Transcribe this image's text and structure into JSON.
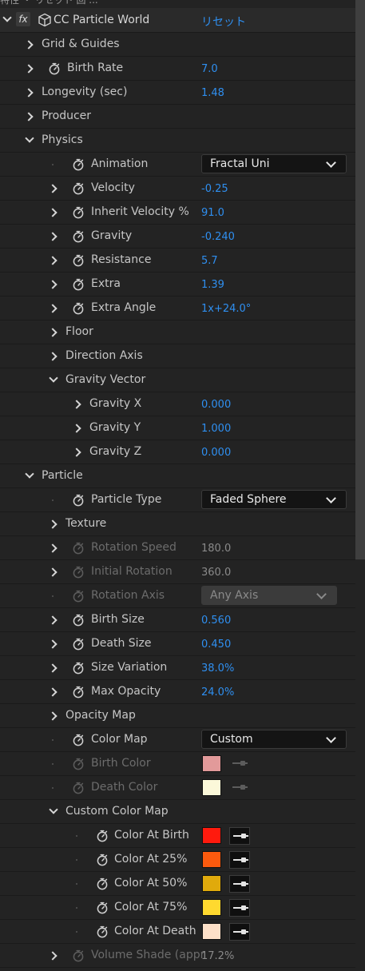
{
  "header_fragment": "特性 ・ リセット 回 ...",
  "effect": {
    "badge": "fx",
    "name": "CC Particle World",
    "reset_label": "リセット",
    "cube_icon": "plugin-cube-icon"
  },
  "rows": [
    {
      "id": "grid-guides",
      "label": "Grid & Guides",
      "level": 1,
      "twirl": "closed",
      "stopwatch": false
    },
    {
      "id": "birth-rate",
      "label": "Birth Rate",
      "level": 1,
      "twirl": "closed",
      "stopwatch": true,
      "value": "7.0"
    },
    {
      "id": "longevity",
      "label": "Longevity (sec)",
      "level": 1,
      "twirl": "closed",
      "stopwatch": false,
      "value": "1.48"
    },
    {
      "id": "producer",
      "label": "Producer",
      "level": 1,
      "twirl": "closed",
      "stopwatch": false
    },
    {
      "id": "physics",
      "label": "Physics",
      "level": 1,
      "twirl": "open",
      "stopwatch": false
    },
    {
      "id": "animation",
      "label": "Animation",
      "level": 2,
      "twirl": "dot",
      "stopwatch": true,
      "dropdown": "Fractal Uni"
    },
    {
      "id": "velocity",
      "label": "Velocity",
      "level": 2,
      "twirl": "closed",
      "stopwatch": true,
      "value": "-0.25"
    },
    {
      "id": "inherit-velocity",
      "label": "Inherit Velocity %",
      "level": 2,
      "twirl": "closed",
      "stopwatch": true,
      "value": "91.0"
    },
    {
      "id": "gravity",
      "label": "Gravity",
      "level": 2,
      "twirl": "closed",
      "stopwatch": true,
      "value": "-0.240"
    },
    {
      "id": "resistance",
      "label": "Resistance",
      "level": 2,
      "twirl": "closed",
      "stopwatch": true,
      "value": "5.7"
    },
    {
      "id": "extra",
      "label": "Extra",
      "level": 2,
      "twirl": "closed",
      "stopwatch": true,
      "value": "1.39"
    },
    {
      "id": "extra-angle",
      "label": "Extra Angle",
      "level": 2,
      "twirl": "closed",
      "stopwatch": true,
      "value": "1x+24.0°"
    },
    {
      "id": "floor",
      "label": "Floor",
      "level": 2,
      "twirl": "closed",
      "stopwatch": false
    },
    {
      "id": "direction-axis",
      "label": "Direction Axis",
      "level": 2,
      "twirl": "closed",
      "stopwatch": false
    },
    {
      "id": "gravity-vector",
      "label": "Gravity Vector",
      "level": 2,
      "twirl": "open",
      "stopwatch": false
    },
    {
      "id": "gravity-x",
      "label": "Gravity X",
      "level": 3,
      "twirl": "closed",
      "stopwatch": false,
      "value": "0.000"
    },
    {
      "id": "gravity-y",
      "label": "Gravity Y",
      "level": 3,
      "twirl": "closed",
      "stopwatch": false,
      "value": "1.000"
    },
    {
      "id": "gravity-z",
      "label": "Gravity Z",
      "level": 3,
      "twirl": "closed",
      "stopwatch": false,
      "value": "0.000"
    },
    {
      "id": "particle",
      "label": "Particle",
      "level": 1,
      "twirl": "open",
      "stopwatch": false
    },
    {
      "id": "particle-type",
      "label": "Particle Type",
      "level": 2,
      "twirl": "dot",
      "stopwatch": true,
      "dropdown": "Faded Sphere"
    },
    {
      "id": "texture",
      "label": "Texture",
      "level": 2,
      "twirl": "closed",
      "stopwatch": false
    },
    {
      "id": "rotation-speed",
      "label": "Rotation Speed",
      "level": 2,
      "twirl": "closed",
      "stopwatch": true,
      "value": "180.0",
      "disabled": true
    },
    {
      "id": "initial-rotation",
      "label": "Initial Rotation",
      "level": 2,
      "twirl": "closed",
      "stopwatch": true,
      "value": "360.0",
      "disabled": true
    },
    {
      "id": "rotation-axis",
      "label": "Rotation Axis",
      "level": 2,
      "twirl": "dot",
      "stopwatch": true,
      "dropdown": "Any Axis",
      "disabled": true
    },
    {
      "id": "birth-size",
      "label": "Birth Size",
      "level": 2,
      "twirl": "closed",
      "stopwatch": true,
      "value": "0.560"
    },
    {
      "id": "death-size",
      "label": "Death Size",
      "level": 2,
      "twirl": "closed",
      "stopwatch": true,
      "value": "0.450"
    },
    {
      "id": "size-variation",
      "label": "Size Variation",
      "level": 2,
      "twirl": "closed",
      "stopwatch": true,
      "value": "38.0%"
    },
    {
      "id": "max-opacity",
      "label": "Max Opacity",
      "level": 2,
      "twirl": "closed",
      "stopwatch": true,
      "value": "24.0%"
    },
    {
      "id": "opacity-map",
      "label": "Opacity Map",
      "level": 2,
      "twirl": "closed",
      "stopwatch": false
    },
    {
      "id": "color-map",
      "label": "Color Map",
      "level": 2,
      "twirl": "dot",
      "stopwatch": true,
      "dropdown": "Custom"
    },
    {
      "id": "birth-color",
      "label": "Birth Color",
      "level": 2,
      "twirl": "dot",
      "stopwatch": true,
      "disabled": true,
      "color": "#e29a9a",
      "eyedropper": true
    },
    {
      "id": "death-color",
      "label": "Death Color",
      "level": 2,
      "twirl": "dot",
      "stopwatch": true,
      "disabled": true,
      "color": "#fbf8d9",
      "eyedropper": true
    },
    {
      "id": "custom-color-map",
      "label": "Custom Color Map",
      "level": 2,
      "twirl": "open",
      "stopwatch": false
    },
    {
      "id": "color-at-birth",
      "label": "Color At Birth",
      "level": 3,
      "twirl": "dot",
      "stopwatch": true,
      "color": "#ff1a0d",
      "eyedropper": true
    },
    {
      "id": "color-at-25",
      "label": "Color At 25%",
      "level": 3,
      "twirl": "dot",
      "stopwatch": true,
      "color": "#fb5a0e",
      "eyedropper": true
    },
    {
      "id": "color-at-50",
      "label": "Color At 50%",
      "level": 3,
      "twirl": "dot",
      "stopwatch": true,
      "color": "#e0aa0c",
      "eyedropper": true
    },
    {
      "id": "color-at-75",
      "label": "Color At 75%",
      "level": 3,
      "twirl": "dot",
      "stopwatch": true,
      "color": "#ffd92f",
      "eyedropper": true
    },
    {
      "id": "color-at-death",
      "label": "Color At Death",
      "level": 3,
      "twirl": "dot",
      "stopwatch": true,
      "color": "#fde0c8",
      "eyedropper": true
    },
    {
      "id": "volume-shade",
      "label": "Volume Shade (appr",
      "level": 2,
      "twirl": "closed",
      "stopwatch": true,
      "value": "17.2%",
      "disabled": true
    }
  ],
  "colors": {
    "value_blue": "#2f8ff0",
    "panel_bg": "#232323",
    "dropdown_bg": "#141414"
  }
}
